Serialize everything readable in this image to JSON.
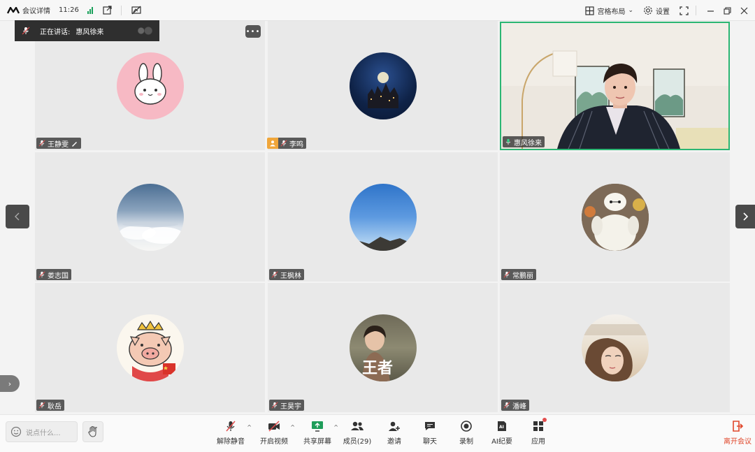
{
  "titlebar": {
    "meeting_details": "会议详情",
    "time": "11:26",
    "layout_label": "宫格布局",
    "settings_label": "设置"
  },
  "speaking": {
    "label": "正在讲话:",
    "speaker": "惠风徐来"
  },
  "tiles": [
    {
      "name": "王静雯",
      "avatar": "bunny"
    },
    {
      "name": "李鸣",
      "avatar": "castle-night"
    },
    {
      "name": "惠风徐来",
      "avatar": "video"
    },
    {
      "name": "娄志国",
      "avatar": "clouds"
    },
    {
      "name": "王枫林",
      "avatar": "blue-sky"
    },
    {
      "name": "常鹏丽",
      "avatar": "baymax"
    },
    {
      "name": "耿岳",
      "avatar": "pig"
    },
    {
      "name": "王昊宇",
      "avatar": "child"
    },
    {
      "name": "潘峰",
      "avatar": "portrait"
    }
  ],
  "toolbar": {
    "chat_placeholder": "说点什么...",
    "unmute": "解除静音",
    "start_video": "开启视频",
    "share_screen": "共享屏幕",
    "members": "成员(29)",
    "invite": "邀请",
    "chat": "聊天",
    "record": "录制",
    "ai_notes": "AI纪要",
    "apps": "应用",
    "leave": "离开会议"
  },
  "colors": {
    "active_border": "#2bb673",
    "leave_red": "#e0472b",
    "signal_green": "#19a05a"
  }
}
